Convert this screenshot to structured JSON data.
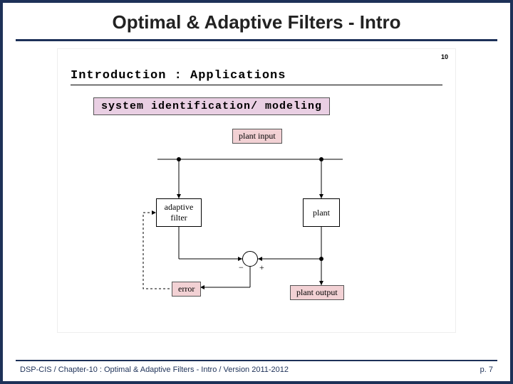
{
  "slide": {
    "title": "Optimal & Adaptive Filters - Intro",
    "corner_number": "10",
    "intro_heading": "Introduction : Applications",
    "highlight": "system identification/ modeling",
    "labels": {
      "plant_input": "plant input",
      "adaptive_filter": "adaptive\nfilter",
      "plant": "plant",
      "error": "error",
      "plant_output": "plant output",
      "minus": "−",
      "plus": "+"
    },
    "footer_left": "DSP-CIS  /  Chapter-10 : Optimal & Adaptive Filters - Intro  /  Version 2011-2012",
    "footer_right": "p. 7"
  }
}
